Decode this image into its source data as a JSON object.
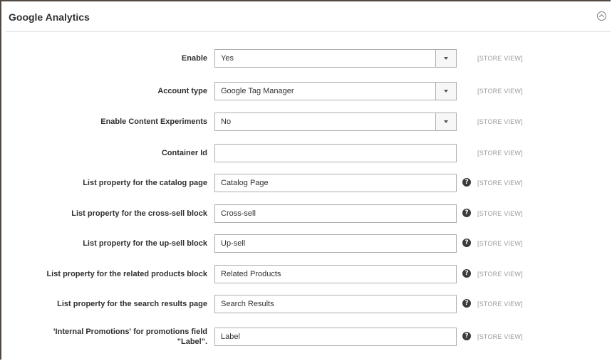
{
  "section": {
    "title": "Google Analytics"
  },
  "scope_label": "[STORE VIEW]",
  "fields": {
    "enable": {
      "label": "Enable",
      "value": "Yes"
    },
    "account_type": {
      "label": "Account type",
      "value": "Google Tag Manager"
    },
    "content_experiments": {
      "label": "Enable Content Experiments",
      "value": "No"
    },
    "container_id": {
      "label": "Container Id",
      "value": ""
    },
    "catalog_page": {
      "label": "List property for the catalog page",
      "value": "Catalog Page"
    },
    "cross_sell": {
      "label": "List property for the cross-sell block",
      "value": "Cross-sell"
    },
    "up_sell": {
      "label": "List property for the up-sell block",
      "value": "Up-sell"
    },
    "related_products": {
      "label": "List property for the related products block",
      "value": "Related Products"
    },
    "search_results": {
      "label": "List property for the search results page",
      "value": "Search Results"
    },
    "internal_promotions": {
      "label_line1": "'Internal Promotions' for promotions field",
      "label_line2": "\"Label\".",
      "value": "Label"
    }
  },
  "help_glyph": "?"
}
